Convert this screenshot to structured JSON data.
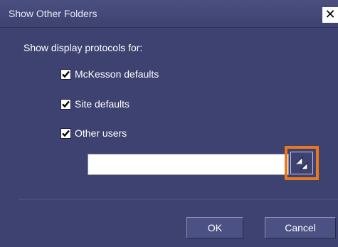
{
  "window": {
    "title": "Show Other Folders",
    "close_glyph": "✕"
  },
  "prompt": "Show display protocols for:",
  "checkboxes": [
    {
      "label": "McKesson defaults",
      "checked": true
    },
    {
      "label": "Site defaults",
      "checked": true
    },
    {
      "label": "Other users",
      "checked": true
    }
  ],
  "user_field": {
    "value": "",
    "picker_icon": "user-picker-icon"
  },
  "buttons": {
    "ok": "OK",
    "cancel": "Cancel"
  },
  "colors": {
    "dialog_background": "#3d4270",
    "highlight": "#e8781e"
  }
}
